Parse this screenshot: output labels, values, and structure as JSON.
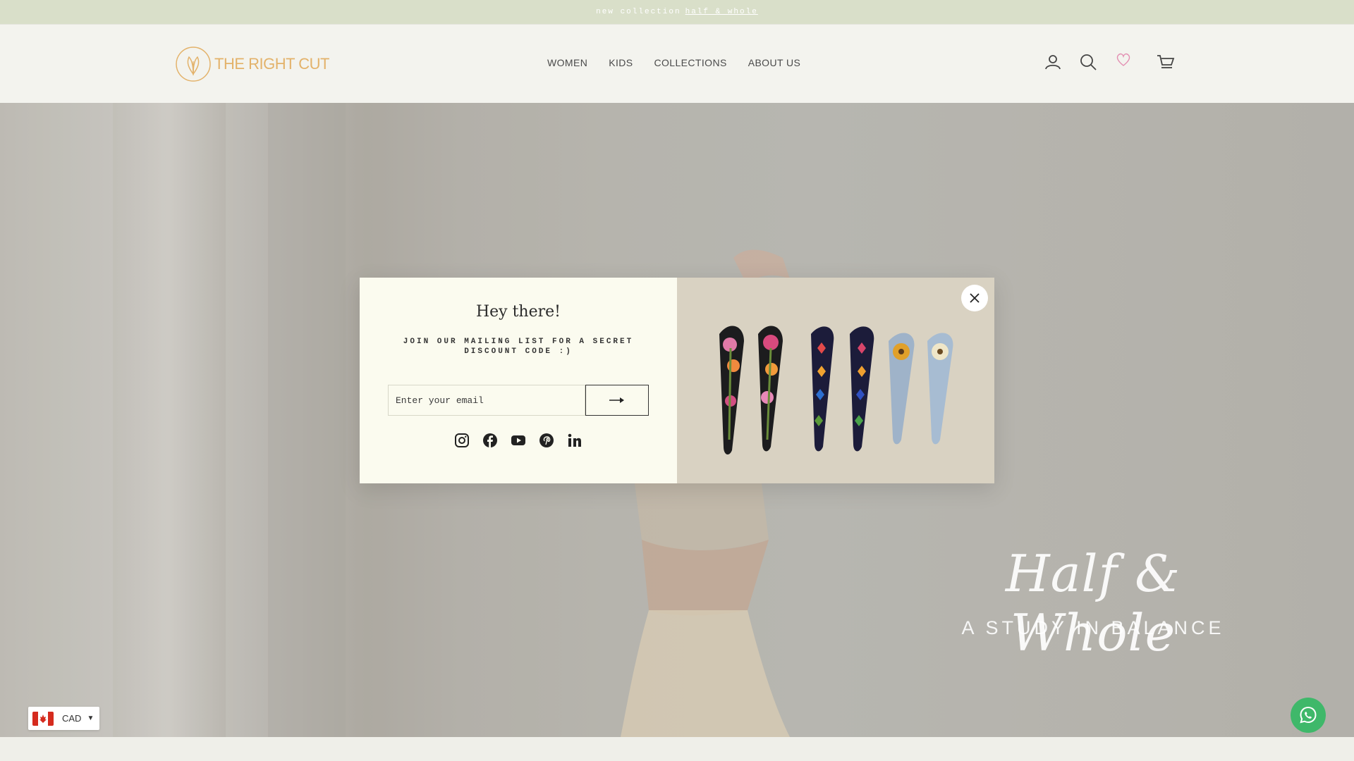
{
  "announcement": {
    "prefix": "new collection",
    "link": "half & whole"
  },
  "brand": {
    "logo_text": "THE RIGHT CUT"
  },
  "nav": {
    "items": [
      "WOMEN",
      "KIDS",
      "COLLECTIONS",
      "ABOUT US"
    ]
  },
  "header_icons": [
    "account-icon",
    "search-icon",
    "wishlist-heart-icon",
    "cart-icon"
  ],
  "hero": {
    "title": "Half & Whole",
    "subtitle": "A STUDY IN BALANCE"
  },
  "popup": {
    "heading": "Hey there!",
    "text": "JOIN OUR MAILING LIST FOR A SECRET DISCOUNT CODE :)",
    "email_placeholder": "Enter your email",
    "socials": [
      "instagram-icon",
      "facebook-icon",
      "youtube-icon",
      "pinterest-icon",
      "linkedin-icon"
    ]
  },
  "currency": {
    "code": "CAD",
    "flag": "canada-flag-icon"
  },
  "colors": {
    "announcement_bg": "#d9dfc9",
    "logo_gold": "#e3b26a",
    "popup_bg": "#fbfbef",
    "whatsapp": "#3fb86a"
  }
}
